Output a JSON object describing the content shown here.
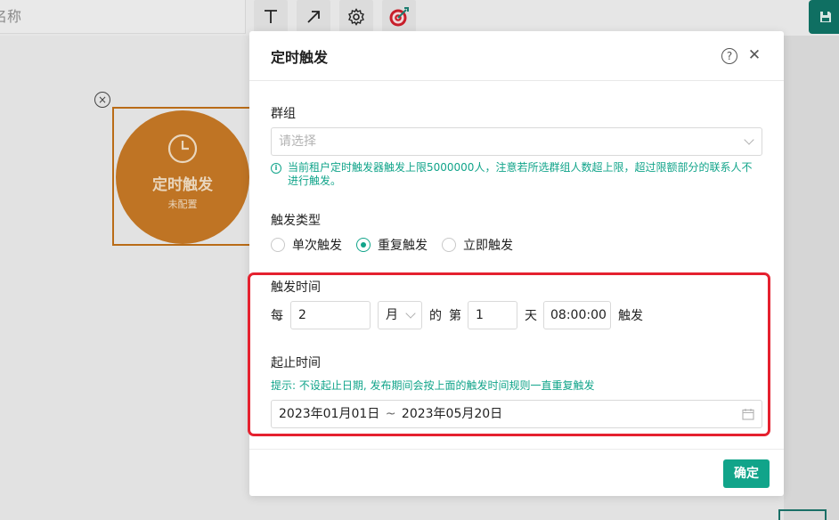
{
  "background": {
    "name_input_text": "名称",
    "toolbar_icons": [
      "text-icon",
      "arrow-icon",
      "gear-icon",
      "target-icon"
    ],
    "save_icon": "save-icon",
    "node": {
      "title": "定时触发",
      "subtitle": "未配置",
      "color": "#bf7424"
    }
  },
  "modal": {
    "title": "定时触发",
    "group_label": "群组",
    "group_placeholder": "请选择",
    "notice": "当前租户定时触发器触发上限5000000人，注意若所选群组人数超上限，超过限额部分的联系人不进行触发。",
    "trigger_type_label": "触发类型",
    "trigger_types": [
      {
        "label": "单次触发",
        "checked": false
      },
      {
        "label": "重复触发",
        "checked": true
      },
      {
        "label": "立即触发",
        "checked": false
      }
    ],
    "trigger_time": {
      "label": "触发时间",
      "every_text": "每",
      "interval_value": "2",
      "unit_value": "月",
      "of_text": "的",
      "nth_text": "第",
      "day_value": "1",
      "day_text": "天",
      "time_value": "08:00:00",
      "trigger_text": "触发"
    },
    "period": {
      "label": "起止时间",
      "hint": "提示: 不设起止日期, 发布期间会按上面的触发时间规则一直重复触发",
      "start": "2023年01月01日",
      "separator": "~",
      "end": "2023年05月20日"
    },
    "confirm_label": "确定"
  },
  "colors": {
    "accent": "#11a48a",
    "highlight": "#e5212f"
  }
}
